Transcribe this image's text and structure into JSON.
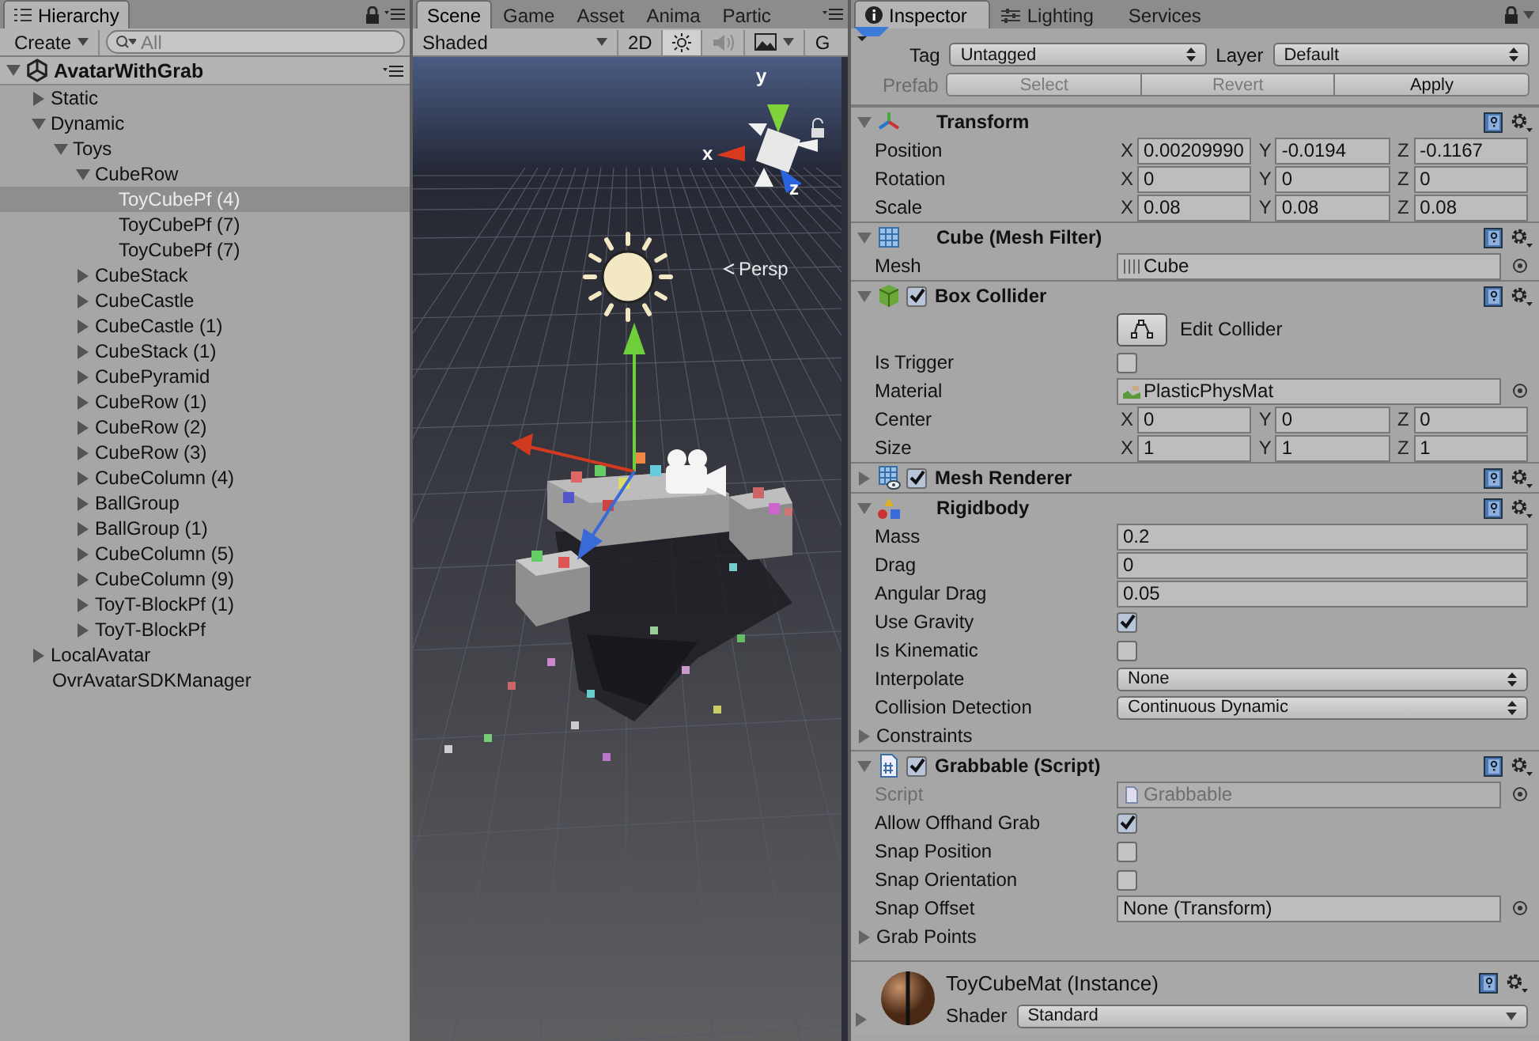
{
  "hierarchy": {
    "tab": {
      "label": "Hierarchy",
      "selected": true
    },
    "create_label": "Create",
    "search_placeholder": "All",
    "scene": {
      "name": "AvatarWithGrab",
      "expanded": true,
      "items": [
        {
          "label": "Static",
          "expanded": false,
          "selected": false
        },
        {
          "label": "Dynamic",
          "expanded": true,
          "selected": false,
          "children": [
            {
              "label": "Toys",
              "expanded": true,
              "selected": false,
              "children": [
                {
                  "label": "CubeRow",
                  "expanded": true,
                  "selected": false,
                  "children": [
                    {
                      "label": "ToyCubePf (4)",
                      "selected": true
                    },
                    {
                      "label": "ToyCubePf (7)",
                      "selected": false
                    },
                    {
                      "label": "ToyCubePf (7)",
                      "selected": false
                    }
                  ]
                },
                {
                  "label": "CubeStack",
                  "expanded": false,
                  "selected": false
                },
                {
                  "label": "CubeCastle",
                  "expanded": false,
                  "selected": false
                },
                {
                  "label": "CubeCastle (1)",
                  "expanded": false,
                  "selected": false
                },
                {
                  "label": "CubeStack (1)",
                  "expanded": false,
                  "selected": false
                },
                {
                  "label": "CubePyramid",
                  "expanded": false,
                  "selected": false
                },
                {
                  "label": "CubeRow (1)",
                  "expanded": false,
                  "selected": false
                },
                {
                  "label": "CubeRow (2)",
                  "expanded": false,
                  "selected": false
                },
                {
                  "label": "CubeRow (3)",
                  "expanded": false,
                  "selected": false
                },
                {
                  "label": "CubeColumn (4)",
                  "expanded": false,
                  "selected": false
                },
                {
                  "label": "BallGroup",
                  "expanded": false,
                  "selected": false
                },
                {
                  "label": "BallGroup (1)",
                  "expanded": false,
                  "selected": false
                },
                {
                  "label": "CubeColumn (5)",
                  "expanded": false,
                  "selected": false
                },
                {
                  "label": "CubeColumn (9)",
                  "expanded": false,
                  "selected": false
                },
                {
                  "label": "ToyT-BlockPf (1)",
                  "expanded": false,
                  "selected": false
                },
                {
                  "label": "ToyT-BlockPf",
                  "expanded": false,
                  "selected": false
                }
              ]
            }
          ]
        },
        {
          "label": "LocalAvatar",
          "expanded": false,
          "selected": false
        },
        {
          "label": "OvrAvatarSDKManager",
          "selected": false
        }
      ]
    }
  },
  "scene_view": {
    "tabs": [
      {
        "label": "Scene",
        "selected": true
      },
      {
        "label": "Game",
        "selected": false
      },
      {
        "label": "Asset",
        "selected": false
      },
      {
        "label": "Anima",
        "selected": false
      },
      {
        "label": "Partic",
        "selected": false
      }
    ],
    "draw_mode": "Shaded",
    "mode_2d": {
      "label": "2D",
      "selected": false
    },
    "lighting_on": true,
    "audio_on": false,
    "gizmos_label": "G",
    "axis_labels": {
      "y": "y",
      "x": "x",
      "z": "z"
    },
    "projection": "Persp"
  },
  "inspector": {
    "tabs": [
      {
        "label": "Inspector",
        "selected": true,
        "kind": "info"
      },
      {
        "label": "Lighting",
        "selected": false,
        "kind": "lighting"
      },
      {
        "label": "Services",
        "selected": false,
        "kind": "plain"
      }
    ],
    "tag_label": "Tag",
    "tag": "Untagged",
    "layer_label": "Layer",
    "layer": "Default",
    "prefab_label": "Prefab",
    "prefab_buttons": [
      {
        "label": "Select",
        "disabled": true
      },
      {
        "label": "Revert",
        "disabled": true
      },
      {
        "label": "Apply",
        "disabled": false
      }
    ],
    "components": [
      {
        "kind": "transform",
        "title": "Transform",
        "expanded": true,
        "rows": [
          {
            "kind": "vector",
            "label": "Position",
            "axes": [
              {
                "axis": "X",
                "value": "0.00209990"
              },
              {
                "axis": "Y",
                "value": "-0.0194"
              },
              {
                "axis": "Z",
                "value": "-0.1167"
              }
            ]
          },
          {
            "kind": "vector",
            "label": "Rotation",
            "axes": [
              {
                "axis": "X",
                "value": "0"
              },
              {
                "axis": "Y",
                "value": "0"
              },
              {
                "axis": "Z",
                "value": "0"
              }
            ]
          },
          {
            "kind": "vector",
            "label": "Scale",
            "axes": [
              {
                "axis": "X",
                "value": "0.08"
              },
              {
                "axis": "Y",
                "value": "0.08"
              },
              {
                "axis": "Z",
                "value": "0.08"
              }
            ]
          }
        ]
      },
      {
        "kind": "mesh-filter",
        "title": "Cube (Mesh Filter)",
        "expanded": true,
        "rows": [
          {
            "kind": "mesh-object",
            "label": "Mesh",
            "value": "Cube"
          }
        ]
      },
      {
        "kind": "box-collider",
        "title": "Box Collider",
        "expanded": true,
        "enabled": true,
        "rows": [
          {
            "kind": "button",
            "label": "Edit Collider"
          },
          {
            "kind": "checkbox",
            "label": "Is Trigger",
            "checked": false
          },
          {
            "kind": "material-object",
            "label": "Material",
            "value": "PlasticPhysMat"
          },
          {
            "kind": "vector",
            "label": "Center",
            "axes": [
              {
                "axis": "X",
                "value": "0"
              },
              {
                "axis": "Y",
                "value": "0"
              },
              {
                "axis": "Z",
                "value": "0"
              }
            ]
          },
          {
            "kind": "vector",
            "label": "Size",
            "axes": [
              {
                "axis": "X",
                "value": "1"
              },
              {
                "axis": "Y",
                "value": "1"
              },
              {
                "axis": "Z",
                "value": "1"
              }
            ]
          }
        ]
      },
      {
        "kind": "mesh-renderer",
        "title": "Mesh Renderer",
        "expanded": false,
        "enabled": true
      },
      {
        "kind": "rigidbody",
        "title": "Rigidbody",
        "expanded": true,
        "rows": [
          {
            "kind": "number",
            "label": "Mass",
            "value": "0.2"
          },
          {
            "kind": "number",
            "label": "Drag",
            "value": "0"
          },
          {
            "kind": "number",
            "label": "Angular Drag",
            "value": "0.05"
          },
          {
            "kind": "checkbox",
            "label": "Use Gravity",
            "checked": true
          },
          {
            "kind": "checkbox",
            "label": "Is Kinematic",
            "checked": false
          },
          {
            "kind": "dropdown",
            "label": "Interpolate",
            "value": "None"
          },
          {
            "kind": "dropdown",
            "label": "Collision Detection",
            "value": "Continuous Dynamic"
          },
          {
            "kind": "foldout",
            "label": "Constraints",
            "expanded": false
          }
        ]
      },
      {
        "kind": "script",
        "title": "Grabbable (Script)",
        "expanded": true,
        "enabled": true,
        "rows": [
          {
            "kind": "script-object",
            "label": "Script",
            "value": "Grabbable",
            "disabled": true
          },
          {
            "kind": "checkbox",
            "label": "Allow Offhand Grab",
            "checked": true
          },
          {
            "kind": "checkbox",
            "label": "Snap Position",
            "checked": false
          },
          {
            "kind": "checkbox",
            "label": "Snap Orientation",
            "checked": false
          },
          {
            "kind": "object",
            "label": "Snap Offset",
            "value": "None (Transform)"
          },
          {
            "kind": "foldout",
            "label": "Grab Points",
            "expanded": false
          }
        ]
      }
    ],
    "material": {
      "name": "ToyCubeMat (Instance)",
      "shader_label": "Shader",
      "shader": "Standard",
      "expanded": false
    }
  }
}
